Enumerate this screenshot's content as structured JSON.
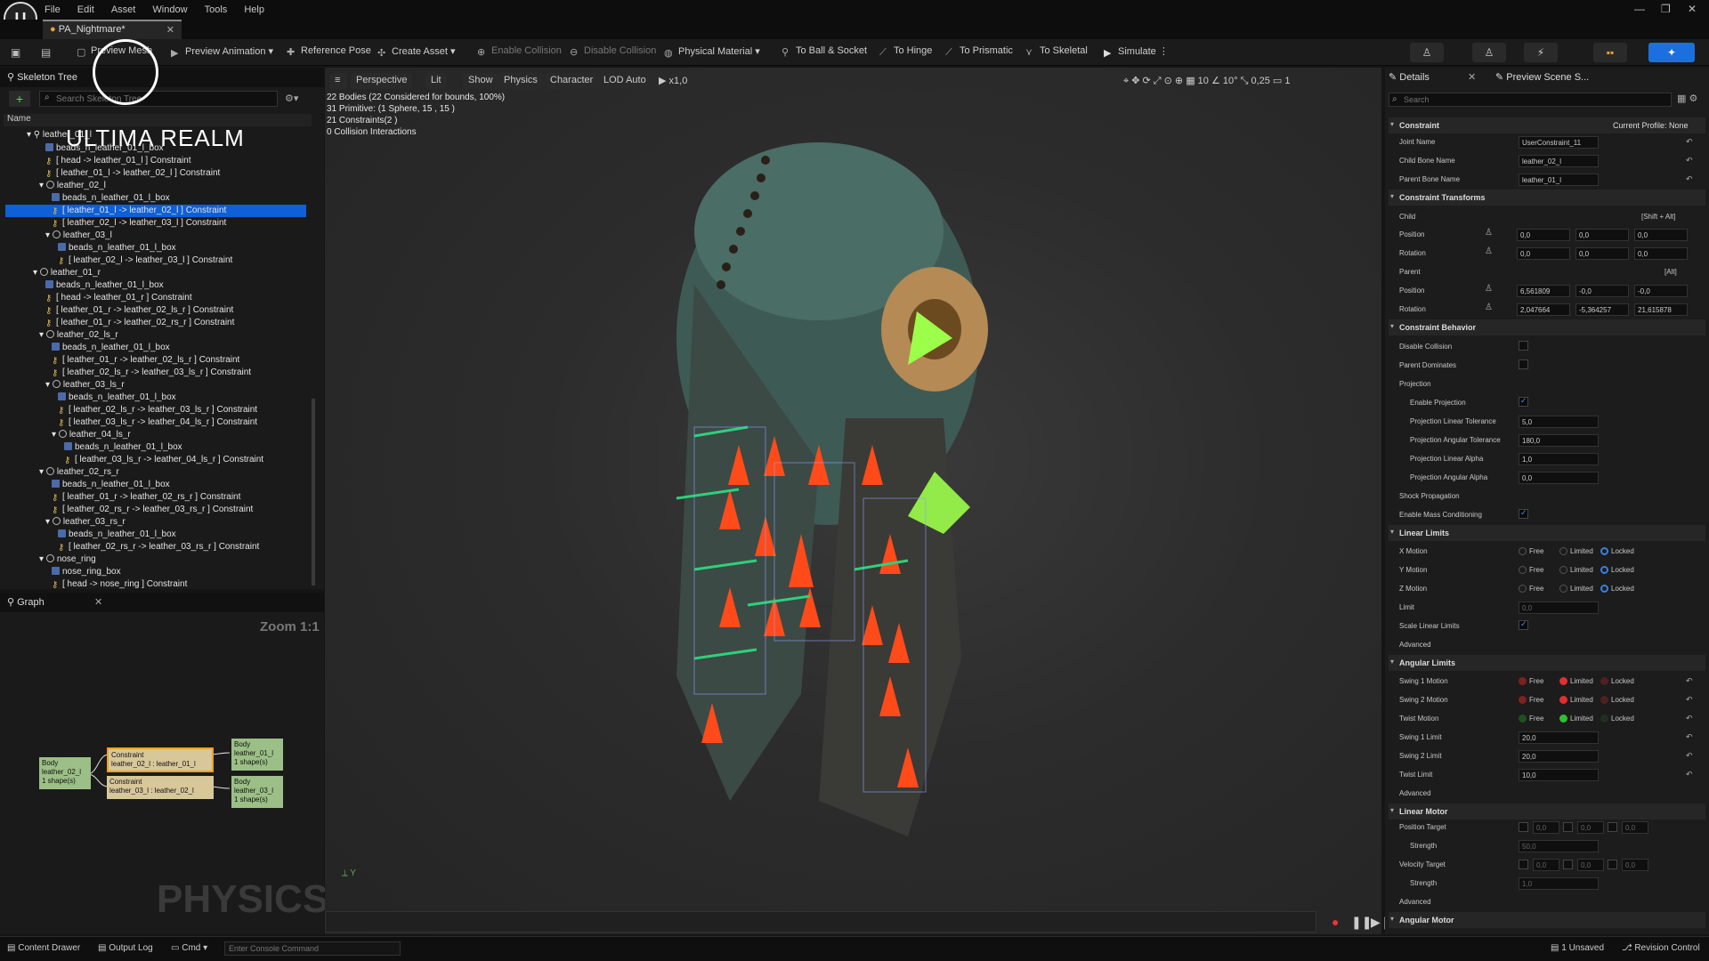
{
  "menu": [
    "File",
    "Edit",
    "Asset",
    "Window",
    "Tools",
    "Help"
  ],
  "doc_tab": "PA_Nightmare*",
  "toolbar": {
    "preview_mesh": "Preview Mesh",
    "preview_animation": "Preview Animation",
    "reference_pose": "Reference Pose",
    "create_asset": "Create Asset",
    "enable_collision": "Enable Collision",
    "disable_collision": "Disable Collision",
    "physical_material": "Physical Material",
    "to_ball": "To Ball & Socket",
    "to_hinge": "To Hinge",
    "to_prismatic": "To Prismatic",
    "to_skeletal": "To Skeletal",
    "simulate": "Simulate"
  },
  "watermark": {
    "text": "ULTIMA REALM"
  },
  "skeleton_tree": {
    "title": "Skeleton Tree",
    "search_placeholder": "Search Skeleton Tree",
    "column": "Name",
    "rows": [
      {
        "text": "beads_n_leather_01_l_box",
        "kind": "body",
        "indent": 3
      },
      {
        "text": "[ head -> leather_01_l ] Constraint",
        "kind": "con",
        "indent": 3
      },
      {
        "text": "[ leather_01_l -> leather_02_l ] Constraint",
        "kind": "con",
        "indent": 3
      },
      {
        "text": "leather_02_l",
        "kind": "bone",
        "indent": 2
      },
      {
        "text": "beads_n_leather_01_l_box",
        "kind": "body",
        "indent": 4
      },
      {
        "text": "[ leather_01_l -> leather_02_l ] Constraint",
        "kind": "con",
        "indent": 4,
        "selected": true
      },
      {
        "text": "[ leather_02_l -> leather_03_l ] Constraint",
        "kind": "con",
        "indent": 4
      },
      {
        "text": "leather_03_l",
        "kind": "bone",
        "indent": 3
      },
      {
        "text": "beads_n_leather_01_l_box",
        "kind": "body",
        "indent": 5
      },
      {
        "text": "[ leather_02_l -> leather_03_l ] Constraint",
        "kind": "con",
        "indent": 5
      },
      {
        "text": "leather_01_r",
        "kind": "bone",
        "indent": 1
      },
      {
        "text": "beads_n_leather_01_l_box",
        "kind": "body",
        "indent": 3
      },
      {
        "text": "[ head -> leather_01_r ] Constraint",
        "kind": "con",
        "indent": 3
      },
      {
        "text": "[ leather_01_r -> leather_02_ls_r ] Constraint",
        "kind": "con",
        "indent": 3
      },
      {
        "text": "[ leather_01_r -> leather_02_rs_r ] Constraint",
        "kind": "con",
        "indent": 3
      },
      {
        "text": "leather_02_ls_r",
        "kind": "bone",
        "indent": 2
      },
      {
        "text": "beads_n_leather_01_l_box",
        "kind": "body",
        "indent": 4
      },
      {
        "text": "[ leather_01_r -> leather_02_ls_r ] Constraint",
        "kind": "con",
        "indent": 4
      },
      {
        "text": "[ leather_02_ls_r -> leather_03_ls_r ] Constraint",
        "kind": "con",
        "indent": 4
      },
      {
        "text": "leather_03_ls_r",
        "kind": "bone",
        "indent": 3
      },
      {
        "text": "beads_n_leather_01_l_box",
        "kind": "body",
        "indent": 5
      },
      {
        "text": "[ leather_02_ls_r -> leather_03_ls_r ] Constraint",
        "kind": "con",
        "indent": 5
      },
      {
        "text": "[ leather_03_ls_r -> leather_04_ls_r ] Constraint",
        "kind": "con",
        "indent": 5
      },
      {
        "text": "leather_04_ls_r",
        "kind": "bone",
        "indent": 4
      },
      {
        "text": "beads_n_leather_01_l_box",
        "kind": "body",
        "indent": 6
      },
      {
        "text": "[ leather_03_ls_r -> leather_04_ls_r ] Constraint",
        "kind": "con",
        "indent": 6
      },
      {
        "text": "leather_02_rs_r",
        "kind": "bone",
        "indent": 2
      },
      {
        "text": "beads_n_leather_01_l_box",
        "kind": "body",
        "indent": 4
      },
      {
        "text": "[ leather_01_r -> leather_02_rs_r ] Constraint",
        "kind": "con",
        "indent": 4
      },
      {
        "text": "[ leather_02_rs_r -> leather_03_rs_r ] Constraint",
        "kind": "con",
        "indent": 4
      },
      {
        "text": "leather_03_rs_r",
        "kind": "bone",
        "indent": 3
      },
      {
        "text": "beads_n_leather_01_l_box",
        "kind": "body",
        "indent": 5
      },
      {
        "text": "[ leather_02_rs_r -> leather_03_rs_r ] Constraint",
        "kind": "con",
        "indent": 5
      },
      {
        "text": "nose_ring",
        "kind": "bone",
        "indent": 2
      },
      {
        "text": "nose_ring_box",
        "kind": "body",
        "indent": 4
      },
      {
        "text": "[ head -> nose_ring ] Constraint",
        "kind": "con",
        "indent": 4
      }
    ]
  },
  "graph": {
    "title": "Graph",
    "zoom": "Zoom 1:1",
    "watermark": "PHYSICS",
    "nodes": {
      "body_left": "Body\nleather_02_l\n1 shape(s)",
      "con1": "Constraint\nleather_02_l : leather_01_l",
      "con2": "Constraint\nleather_03_l : leather_02_l",
      "body_r1": "Body\nleather_01_l\n1 shape(s)",
      "body_r2": "Body\nleather_03_l\n1 shape(s)"
    }
  },
  "viewport": {
    "buttons": {
      "perspective": "Perspective",
      "lit": "Lit",
      "show": "Show",
      "physics": "Physics",
      "character": "Character",
      "lod": "LOD Auto",
      "speed": "x1,0"
    },
    "right": {
      "grid": "10",
      "angle": "10°",
      "scale": "0,25",
      "cams": "1"
    },
    "stats": [
      "22 Bodies (22 Considered for bounds, 100%)",
      "31 Primitive: (1 Sphere, 15 , 15 )",
      "21 Constraints(2 )",
      "0 Collision Interactions"
    ]
  },
  "details": {
    "tab1": "Details",
    "tab2": "Preview Scene S...",
    "search_placeholder": "Search",
    "constraint": {
      "title": "Constraint",
      "profile": "Current Profile: None",
      "joint_name_label": "Joint Name",
      "joint_name": "UserConstraint_11",
      "child_bone_label": "Child Bone Name",
      "child_bone": "leather_02_l",
      "parent_bone_label": "Parent Bone Name",
      "parent_bone": "leather_01_l"
    },
    "transforms": {
      "title": "Constraint Transforms",
      "child": "Child",
      "child_hint": "[Shift + Alt]",
      "parent": "Parent",
      "parent_hint": "[Alt]",
      "position": "Position",
      "rotation": "Rotation",
      "child_pos": [
        "0,0",
        "0,0",
        "0,0"
      ],
      "child_rot": [
        "0,0",
        "0,0",
        "0,0"
      ],
      "parent_pos": [
        "6,561809",
        "-0,0",
        "-0,0"
      ],
      "parent_rot": [
        "2,047664",
        "-5,364257",
        "21,615878"
      ]
    },
    "behavior": {
      "title": "Constraint Behavior",
      "disable_collision": "Disable Collision",
      "parent_dominates": "Parent Dominates",
      "projection": "Projection",
      "enable_projection": "Enable Projection",
      "lin_tol_label": "Projection Linear Tolerance",
      "lin_tol": "5,0",
      "ang_tol_label": "Projection Angular Tolerance",
      "ang_tol": "180,0",
      "lin_alpha_label": "Projection Linear Alpha",
      "lin_alpha": "1,0",
      "ang_alpha_label": "Projection Angular Alpha",
      "ang_alpha": "0,0",
      "shock": "Shock Propagation",
      "mass": "Enable Mass Conditioning"
    },
    "linear": {
      "title": "Linear Limits",
      "x": "X Motion",
      "y": "Y Motion",
      "z": "Z Motion",
      "free": "Free",
      "limited": "Limited",
      "locked": "Locked",
      "limit_label": "Limit",
      "limit": "0,0",
      "scale": "Scale Linear Limits",
      "advanced": "Advanced"
    },
    "angular": {
      "title": "Angular Limits",
      "s1": "Swing 1 Motion",
      "s2": "Swing 2 Motion",
      "tw": "Twist Motion",
      "s1l_label": "Swing 1 Limit",
      "s1l": "20,0",
      "s2l_label": "Swing 2 Limit",
      "s2l": "20,0",
      "twl_label": "Twist Limit",
      "twl": "10,0",
      "advanced": "Advanced"
    },
    "motor": {
      "title": "Linear Motor",
      "pos_target": "Position Target",
      "strength": "Strength",
      "strength1": "50,0",
      "vel_target": "Velocity Target",
      "strength2": "1,0",
      "vals": [
        "0,0",
        "0,0",
        "0,0"
      ],
      "advanced": "Advanced",
      "angular": "Angular Motor"
    }
  },
  "statusbar": {
    "content_drawer": "Content Drawer",
    "output_log": "Output Log",
    "cmd": "Cmd",
    "console_placeholder": "Enter Console Command",
    "unsaved": "1 Unsaved",
    "revision": "Revision Control"
  }
}
